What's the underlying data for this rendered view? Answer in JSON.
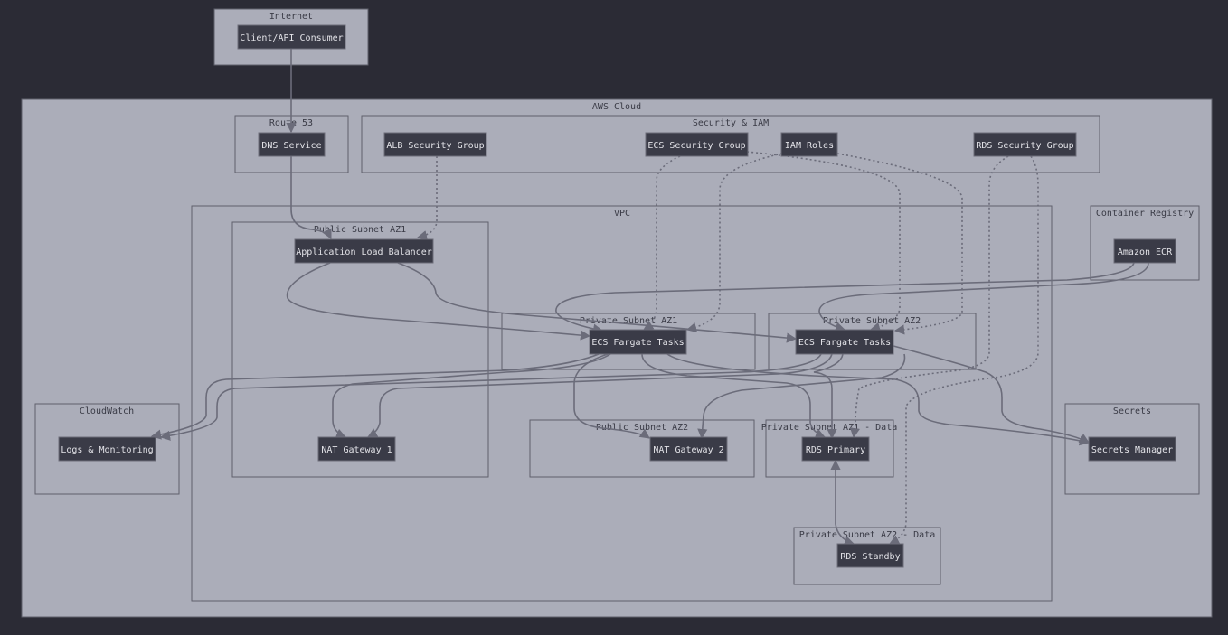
{
  "colors": {
    "background": "#2b2b35",
    "cluster_fill": "#abadb9",
    "internet_fill": "#abadb9",
    "node_fill": "#3a3b47",
    "node_text": "#e3e3e8",
    "edge": "#6b6c7a"
  },
  "clusters": {
    "internet": "Internet",
    "aws_cloud": "AWS Cloud",
    "route53": "Route 53",
    "security_iam": "Security & IAM",
    "vpc": "VPC",
    "container_registry": "Container Registry",
    "public_subnet_az1": "Public Subnet AZ1",
    "private_subnet_az1": "Private Subnet AZ1",
    "private_subnet_az2": "Private Subnet AZ2",
    "cloudwatch": "CloudWatch",
    "public_subnet_az2": "Public Subnet AZ2",
    "private_subnet_az1_data": "Private Subnet AZ1 - Data",
    "secrets": "Secrets",
    "private_subnet_az2_data": "Private Subnet AZ2 - Data"
  },
  "nodes": {
    "client": "Client/API Consumer",
    "dns": "DNS Service",
    "alb_sg": "ALB Security Group",
    "ecs_sg": "ECS Security Group",
    "iam_roles": "IAM Roles",
    "rds_sg": "RDS Security Group",
    "alb": "Application Load Balancer",
    "ecr": "Amazon ECR",
    "ecs1": "ECS Fargate Tasks",
    "ecs2": "ECS Fargate Tasks",
    "logs": "Logs & Monitoring",
    "nat1": "NAT Gateway 1",
    "nat2": "NAT Gateway 2",
    "rds_primary": "RDS Primary",
    "secrets_manager": "Secrets Manager",
    "rds_standby": "RDS Standby"
  }
}
